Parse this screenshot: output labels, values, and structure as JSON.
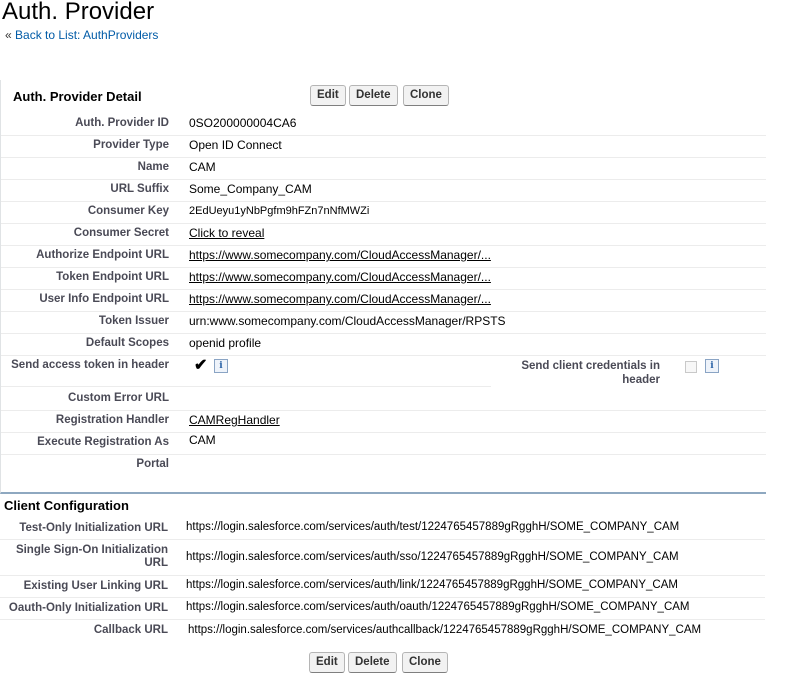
{
  "header": {
    "title": "Auth. Provider",
    "back_prefix": "« ",
    "back_link": "Back to List: AuthProviders"
  },
  "buttons": {
    "edit": "Edit",
    "delete": "Delete",
    "clone": "Clone"
  },
  "detail": {
    "section_title": "Auth. Provider Detail",
    "rows": [
      {
        "label": "Auth. Provider ID",
        "value": "0SO200000004CA6"
      },
      {
        "label": "Provider Type",
        "value": "Open ID Connect"
      },
      {
        "label": "Name",
        "value": "CAM"
      },
      {
        "label": "URL Suffix",
        "value": "Some_Company_CAM"
      },
      {
        "label": "Consumer Key",
        "value": "2EdUeyu1yNbPgfm9hFZn7nNfMWZi"
      },
      {
        "label": "Consumer Secret",
        "value": "Click to reveal"
      },
      {
        "label": "Authorize Endpoint URL",
        "value": "https://www.somecompany.com/CloudAccessManager/..."
      },
      {
        "label": "Token Endpoint URL",
        "value": "https://www.somecompany.com/CloudAccessManager/..."
      },
      {
        "label": "User Info Endpoint URL",
        "value": "https://www.somecompany.com/CloudAccessManager/..."
      },
      {
        "label": "Token Issuer",
        "value": "urn:www.somecompany.com/CloudAccessManager/RPSTS"
      },
      {
        "label": "Default Scopes",
        "value": "openid profile"
      }
    ],
    "send_access_token_label": "Send access token in header",
    "send_access_token_value": "✔",
    "send_client_credentials_label": "Send client credentials in header",
    "info_glyph": "i",
    "rows2": [
      {
        "label": "Custom Error URL",
        "value": ""
      },
      {
        "label": "Registration Handler",
        "value": "CAMRegHandler"
      },
      {
        "label": "Execute Registration As",
        "value": "CAM"
      },
      {
        "label": "Portal",
        "value": ""
      }
    ]
  },
  "client_config": {
    "section_title": "Client Configuration",
    "rows": [
      {
        "label": "Test-Only Initialization URL",
        "value": "https://login.salesforce.com/services/auth/test/1224765457889gRgghH/SOME_COMPANY_CAM"
      },
      {
        "label": "Single Sign-On Initialization URL",
        "value": "https://login.salesforce.com/services/auth/sso/1224765457889gRgghH/SOME_COMPANY_CAM"
      },
      {
        "label": "Existing User Linking URL",
        "value": "https://login.salesforce.com/services/auth/link/1224765457889gRgghH/SOME_COMPANY_CAM"
      },
      {
        "label": "Oauth-Only Initialization URL",
        "value": "https://login.salesforce.com/services/auth/oauth/1224765457889gRgghH/SOME_COMPANY_CAM"
      },
      {
        "label": "Callback URL",
        "value": "https://login.salesforce.com/services/authcallback/1224765457889gRgghH/SOME_COMPANY_CAM"
      }
    ]
  }
}
